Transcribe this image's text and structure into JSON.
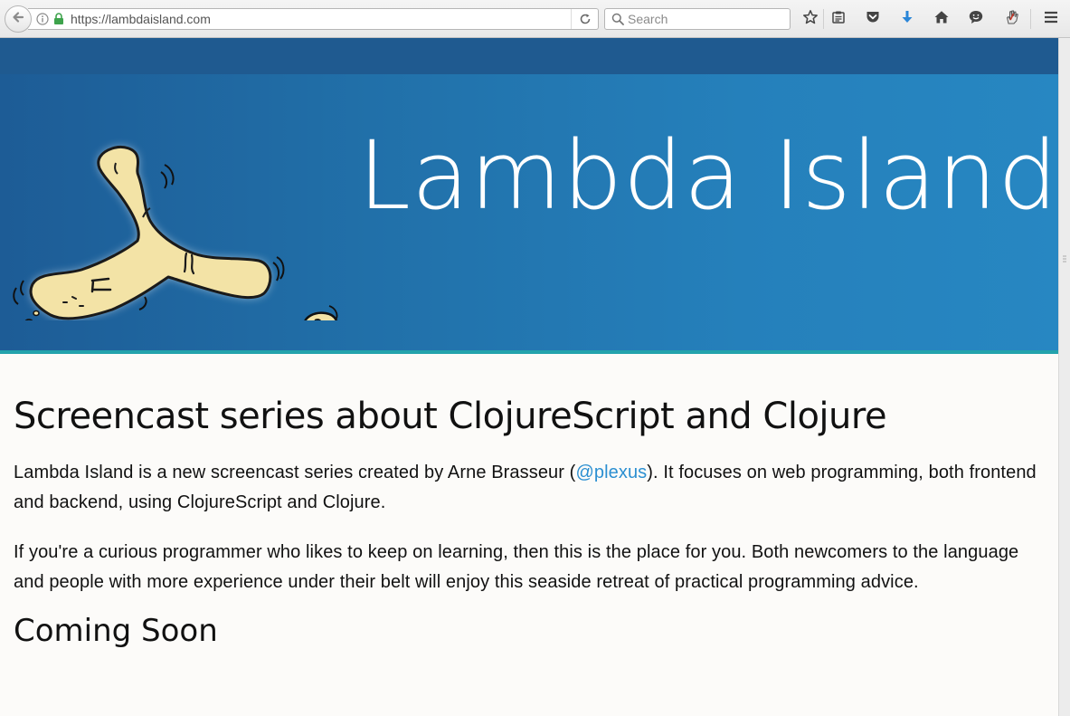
{
  "browser": {
    "url": "https://lambdaisland.com",
    "search_placeholder": "Search",
    "icons": {
      "back": "back-arrow-icon",
      "info": "info-icon",
      "lock": "lock-icon",
      "reload": "reload-icon",
      "search": "search-icon",
      "bookmark": "star-icon",
      "reader": "clipboard-icon",
      "pocket": "pocket-icon",
      "downloads": "download-arrow-icon",
      "home": "home-icon",
      "chat": "chat-bubble-icon",
      "extension": "hand-icon",
      "menu": "hamburger-menu-icon"
    }
  },
  "hero": {
    "title": "Lambda Island"
  },
  "content": {
    "heading": "Screencast series about ClojureScript and Clojure",
    "intro_before": "Lambda Island is a new screencast series created by Arne Brasseur (",
    "intro_link": "@plexus",
    "intro_after": "). It focuses on web programming, both frontend and backend, using ClojureScript and Clojure.",
    "para2": "If you're a curious programmer who likes to keep on learning, then this is the place for you. Both newcomers to the language and people with more experience under their belt will enjoy this seaside retreat of practical programming advice.",
    "subheading": "Coming Soon"
  },
  "colors": {
    "hero_start": "#1d5c96",
    "hero_end": "#2787c2",
    "hero_border": "#23a3ac",
    "link": "#2b8fd1",
    "island_fill": "#f3e3a6",
    "download_arrow": "#2a86d8"
  }
}
